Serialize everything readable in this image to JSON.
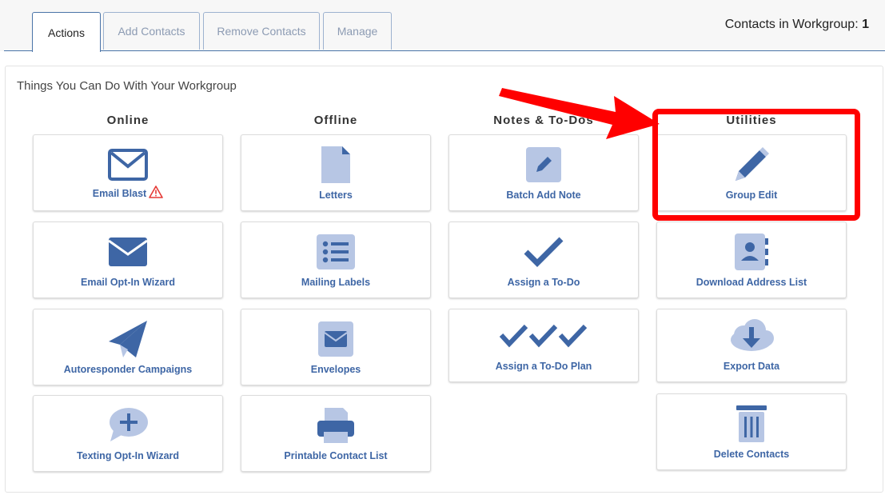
{
  "tabs": [
    {
      "label": "Actions",
      "active": true
    },
    {
      "label": "Add Contacts",
      "active": false
    },
    {
      "label": "Remove Contacts",
      "active": false
    },
    {
      "label": "Manage",
      "active": false
    }
  ],
  "contacts_count": {
    "label": "Contacts in Workgroup:",
    "value": "1"
  },
  "panel_title": "Things You Can Do With Your Workgroup",
  "columns": {
    "online": {
      "title": "Online",
      "items": [
        {
          "label": "Email Blast",
          "icon": "envelope-outline-icon",
          "warning": true
        },
        {
          "label": "Email Opt-In Wizard",
          "icon": "envelope-solid-icon"
        },
        {
          "label": "Autoresponder Campaigns",
          "icon": "paper-plane-icon"
        },
        {
          "label": "Texting Opt-In Wizard",
          "icon": "chat-plus-icon"
        }
      ]
    },
    "offline": {
      "title": "Offline",
      "items": [
        {
          "label": "Letters",
          "icon": "document-icon"
        },
        {
          "label": "Mailing Labels",
          "icon": "list-icon"
        },
        {
          "label": "Envelopes",
          "icon": "envelope-square-icon"
        },
        {
          "label": "Printable Contact List",
          "icon": "printer-icon"
        }
      ]
    },
    "notes": {
      "title": "Notes & To-Dos",
      "items": [
        {
          "label": "Batch Add Note",
          "icon": "note-pencil-icon"
        },
        {
          "label": "Assign a To-Do",
          "icon": "checkmark-icon"
        },
        {
          "label": "Assign a To-Do Plan",
          "icon": "triple-checkmark-icon"
        }
      ]
    },
    "utilities": {
      "title": "Utilities",
      "items": [
        {
          "label": "Group Edit",
          "icon": "pencil-icon"
        },
        {
          "label": "Download Address List",
          "icon": "address-book-icon"
        },
        {
          "label": "Export Data",
          "icon": "cloud-download-icon"
        },
        {
          "label": "Delete Contacts",
          "icon": "trash-icon"
        }
      ]
    }
  },
  "colors": {
    "primary": "#3e66a5",
    "light": "#b7c6e4",
    "highlight": "#ff0000",
    "warning": "#e53935"
  }
}
